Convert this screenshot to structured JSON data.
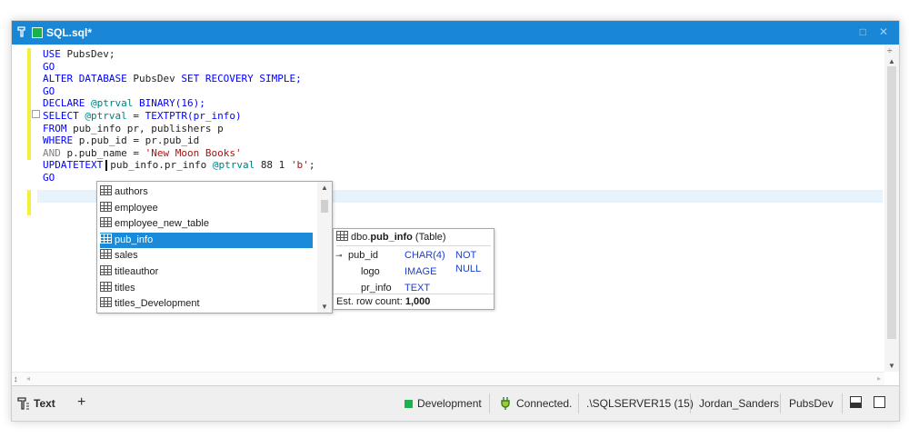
{
  "window": {
    "title": "SQL.sql*"
  },
  "editor": {
    "lines": [
      {
        "t": "USE PubsDev;"
      },
      {
        "t": "GO"
      },
      {
        "t": "ALTER DATABASE PubsDev SET RECOVERY SIMPLE;"
      },
      {
        "t": "GO"
      },
      {
        "t": "DECLARE @ptrval BINARY(16);"
      },
      {
        "t": "SELECT @ptrval = TEXTPTR(pr_info)"
      },
      {
        "t": "FROM pub_info pr, publishers p"
      },
      {
        "t": "WHERE p.pub_id = pr.pub_id"
      },
      {
        "t": "AND p.pub_name = 'New Moon Books'"
      },
      {
        "t": "UPDATETEXT pub_info.pr_info @ptrval 88 1 'b';"
      },
      {
        "t": "GO"
      }
    ],
    "tokens": {
      "use": "USE",
      "pubsdev": "PubsDev;",
      "go": "GO",
      "alter": "ALTER DATABASE",
      "pubsdev2": "PubsDev",
      "set": "SET RECOVERY SIMPLE;",
      "declare": "DECLARE",
      "ptrval": "@ptrval",
      "binary": "BINARY(16);",
      "select": "SELECT",
      "eq": "=",
      "textptr": "TEXTPTR(pr_info)",
      "from": "FROM",
      "fromrest": "pub_info pr, publishers p",
      "where": "WHERE",
      "whererest": "p.pub_id = pr.pub_id",
      "and": "AND",
      "andrest": "p.pub_name =",
      "str1": "'New Moon Books'",
      "updatetext": "UPDATETEXT",
      "uprest1": "pub_info.pr_info",
      "uprest2": "88 1",
      "str2": "'b'",
      "semi": ";"
    }
  },
  "autocomplete": {
    "items": [
      "authors",
      "employee",
      "employee_new_table",
      "pub_info",
      "sales",
      "titleauthor",
      "titles",
      "titles_Development"
    ],
    "selected_index": 3
  },
  "table_info": {
    "schema": "dbo.",
    "name": "pub_info",
    "kind": "(Table)",
    "columns": [
      {
        "name": "pub_id",
        "type": "CHAR(4)",
        "extra": "NOT NULL",
        "key": true
      },
      {
        "name": "logo",
        "type": "IMAGE",
        "extra": ""
      },
      {
        "name": "pr_info",
        "type": "TEXT",
        "extra": ""
      }
    ],
    "row_count_label": "Est. row count:",
    "row_count": "1,000"
  },
  "statusbar": {
    "tab_label": "Text",
    "add_label": "+",
    "environment": "Development",
    "connection": "Connected.",
    "server": ".\\SQLSERVER15 (15)",
    "user": "Jordan_Sanders",
    "database": "PubsDev"
  },
  "colors": {
    "accent": "#1a86d6",
    "environment": "#1bb24b",
    "selection": "#1a8ad9",
    "keyword": "#0000ff",
    "string": "#a31515"
  },
  "icons": [
    "sql-document-icon",
    "table-icon",
    "primary-key-icon",
    "plug-icon",
    "split-horizontal-icon",
    "split-vertical-icon"
  ]
}
